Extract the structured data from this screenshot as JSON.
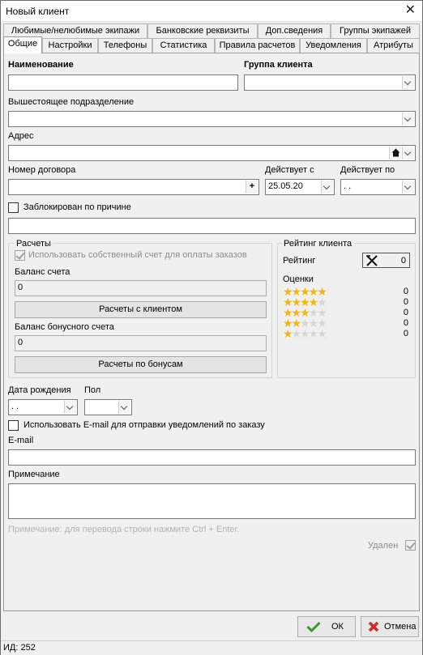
{
  "window": {
    "title": "Новый клиент"
  },
  "tabs_row1": [
    "Любимые/нелюбимые экипажи",
    "Банковские реквизиты",
    "Доп.сведения",
    "Группы экипажей"
  ],
  "tabs_row2": [
    "Общие",
    "Настройки",
    "Телефоны",
    "Статистика",
    "Правила расчетов",
    "Уведомления",
    "Атрибуты"
  ],
  "form": {
    "name_label": "Наименование",
    "name_value": "",
    "group_label": "Группа клиента",
    "group_value": "",
    "parent_label": "Вышестоящее подразделение",
    "parent_value": "",
    "address_label": "Адрес",
    "address_value": "",
    "contract_label": "Номер договора",
    "contract_value": "",
    "contract_add": "+",
    "valid_from_label": "Действует с",
    "valid_from_value": "25.05.20",
    "valid_to_label": "Действует по",
    "valid_to_value": " . .",
    "blocked_label": "Заблокирован по причине",
    "blocked_reason": ""
  },
  "payments": {
    "title": "Расчеты",
    "own_account_label": "Использовать собственный счет для оплаты заказов",
    "balance_label": "Баланс счета",
    "balance_value": "0",
    "settlements_button": "Расчеты с клиентом",
    "bonus_balance_label": "Баланс бонусного счета",
    "bonus_balance_value": "0",
    "bonus_button": "Расчеты по бонусам"
  },
  "rating": {
    "title": "Рейтинг клиента",
    "rating_label": "Рейтинг",
    "rating_value": "0",
    "scores_label": "Оценки",
    "rows": [
      {
        "stars": 5,
        "count": "0"
      },
      {
        "stars": 4,
        "count": "0"
      },
      {
        "stars": 3,
        "count": "0"
      },
      {
        "stars": 2,
        "count": "0"
      },
      {
        "stars": 1,
        "count": "0"
      }
    ],
    "star_color": "#f2b70c"
  },
  "personal": {
    "birth_label": "Дата рождения",
    "birth_value": " . .",
    "gender_label": "Пол",
    "gender_value": "",
    "email_notify_label": "Использовать E-mail для отправки уведомлений по заказу",
    "email_label": "E-mail",
    "email_value": "",
    "note_label": "Примечание",
    "note_value": "",
    "note_hint": "Примечание: для перевода строки нажмите Ctrl + Enter.",
    "deleted_label": "Удален"
  },
  "footer": {
    "ok_label": "ОК",
    "cancel_label": "Отмена"
  },
  "status": {
    "id_text": "ИД: 252"
  }
}
